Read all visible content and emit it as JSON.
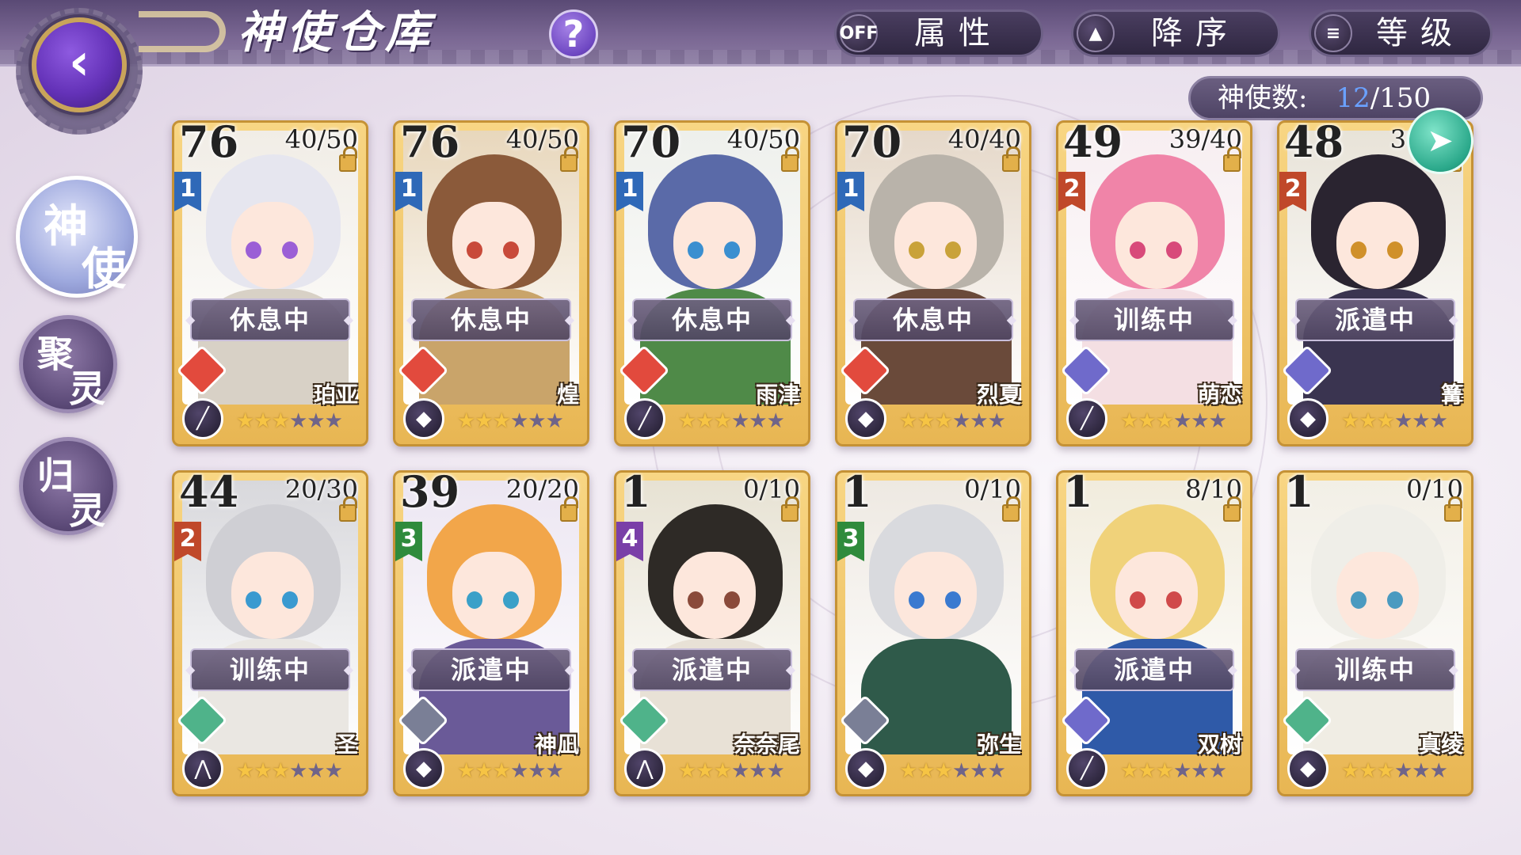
{
  "header": {
    "title": "神使仓库",
    "help_label": "?",
    "attribute_toggle": {
      "state": "OFF",
      "label": "属性"
    },
    "sort_order": {
      "icon": "sort-up-down-icon",
      "label": "降序"
    },
    "sort_key": {
      "icon": "list-filter-icon",
      "label": "等级"
    }
  },
  "counter": {
    "label": "神使数:",
    "current": "12",
    "max": "/150"
  },
  "side_tabs": [
    {
      "c1": "神",
      "c2": "使",
      "active": true
    },
    {
      "c1": "聚",
      "c2": "灵",
      "active": false
    },
    {
      "c1": "归",
      "c2": "灵",
      "active": false
    }
  ],
  "colors": {
    "rank1": "#2f69b8",
    "rank2": "#c0482a",
    "rank3": "#2f8b3c",
    "rank4": "#7a3fa8",
    "fire": "#e24a3d",
    "wind": "#4fb38a",
    "water": "#6f6acb",
    "earth": "#7a7f96"
  },
  "cards": [
    {
      "level": "76",
      "cap": "40/50",
      "rank": "1",
      "rankColor": "#2f69b8",
      "status": "休息中",
      "name": "珀亚",
      "element": "#e24a3d",
      "weapon": "╱",
      "stars": 3,
      "hair": "#e6e6ef",
      "eye": "#9b5fd6",
      "body": "#d8d1c6",
      "bg": "#f1ede6"
    },
    {
      "level": "76",
      "cap": "40/50",
      "rank": "1",
      "rankColor": "#2f69b8",
      "status": "休息中",
      "name": "煌",
      "element": "#e24a3d",
      "weapon": "◆",
      "stars": 3,
      "hair": "#8b5a3a",
      "eye": "#c84a3a",
      "body": "#c9a46a",
      "bg": "#e8d7bc"
    },
    {
      "level": "70",
      "cap": "40/50",
      "rank": "1",
      "rankColor": "#2f69b8",
      "status": "休息中",
      "name": "雨津",
      "element": "#e24a3d",
      "weapon": "╱",
      "stars": 3,
      "hair": "#5a6aa8",
      "eye": "#3a8fd0",
      "body": "#4f8a48",
      "bg": "#eef0ec"
    },
    {
      "level": "70",
      "cap": "40/40",
      "rank": "1",
      "rankColor": "#2f69b8",
      "status": "休息中",
      "name": "烈夏",
      "element": "#e24a3d",
      "weapon": "◆",
      "stars": 3,
      "hair": "#b9b3aa",
      "eye": "#c9a23a",
      "body": "#6a4a3a",
      "bg": "#e5d8c9"
    },
    {
      "level": "49",
      "cap": "39/40",
      "rank": "2",
      "rankColor": "#c0482a",
      "status": "训练中",
      "name": "萌恋",
      "element": "#6f6acb",
      "weapon": "╱",
      "stars": 3,
      "hair": "#f084a8",
      "eye": "#d84a7a",
      "body": "#f4dfe3",
      "bg": "#f7eef1"
    },
    {
      "level": "48",
      "cap": "30/40",
      "rank": "2",
      "rankColor": "#c0482a",
      "status": "派遣中",
      "name": "篝",
      "element": "#6f6acb",
      "weapon": "◆",
      "stars": 3,
      "hair": "#2a2430",
      "eye": "#d0902a",
      "body": "#3a3450",
      "bg": "#e8e3d8"
    },
    {
      "level": "44",
      "cap": "20/30",
      "rank": "2",
      "rankColor": "#c0482a",
      "status": "训练中",
      "name": "圣",
      "element": "#4fb38a",
      "weapon": "⋀",
      "stars": 3,
      "hair": "#cfcfd4",
      "eye": "#3a9ad0",
      "body": "#eae7e2",
      "bg": "#d8d8dc"
    },
    {
      "level": "39",
      "cap": "20/20",
      "rank": "3",
      "rankColor": "#2f8b3c",
      "status": "派遣中",
      "name": "神凪",
      "element": "#7a7f96",
      "weapon": "◆",
      "stars": 3,
      "hair": "#f2a64a",
      "eye": "#3aa0c8",
      "body": "#6a5a98",
      "bg": "#ece6f2"
    },
    {
      "level": "1",
      "cap": "0/10",
      "rank": "4",
      "rankColor": "#7a3fa8",
      "status": "派遣中",
      "name": "奈奈尾",
      "element": "#4fb38a",
      "weapon": "⋀",
      "stars": 3,
      "hair": "#2e2a26",
      "eye": "#8a4a3a",
      "body": "#e8e1d6",
      "bg": "#e7e2d3"
    },
    {
      "level": "1",
      "cap": "0/10",
      "rank": "3",
      "rankColor": "#2f8b3c",
      "status": "",
      "name": "弥生",
      "element": "#7a7f96",
      "weapon": "◆",
      "stars": 3,
      "hair": "#d9dade",
      "eye": "#3a7ad0",
      "body": "#2f5a4a",
      "bg": "#eee9e2"
    },
    {
      "level": "1",
      "cap": "8/10",
      "rank": "",
      "rankColor": "",
      "status": "派遣中",
      "name": "双树",
      "element": "#6f6acb",
      "weapon": "╱",
      "stars": 3,
      "hair": "#f0d27a",
      "eye": "#d04a4a",
      "body": "#2f5aa8",
      "bg": "#f1ecdd"
    },
    {
      "level": "1",
      "cap": "0/10",
      "rank": "",
      "rankColor": "",
      "status": "训练中",
      "name": "真绫",
      "element": "#4fb38a",
      "weapon": "◆",
      "stars": 3,
      "hair": "#efeee8",
      "eye": "#4a9ac0",
      "body": "#f0ede4",
      "bg": "#f2efe6"
    }
  ]
}
